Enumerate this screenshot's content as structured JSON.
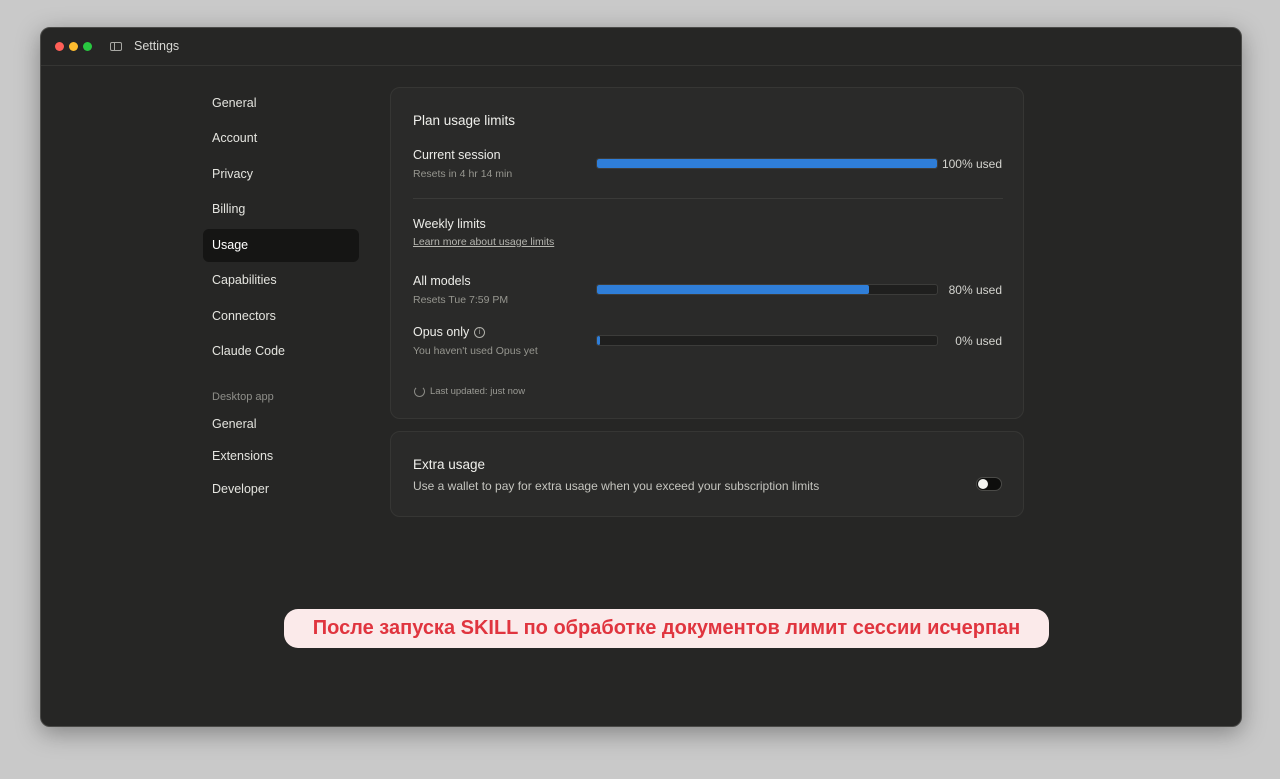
{
  "window": {
    "title": "Settings"
  },
  "nav": {
    "items": [
      {
        "label": "General"
      },
      {
        "label": "Account"
      },
      {
        "label": "Privacy"
      },
      {
        "label": "Billing"
      },
      {
        "label": "Usage",
        "active": true
      },
      {
        "label": "Capabilities"
      },
      {
        "label": "Connectors"
      },
      {
        "label": "Claude Code"
      }
    ],
    "desktop_section_label": "Desktop app",
    "desktop_items": [
      {
        "label": "General"
      },
      {
        "label": "Extensions"
      },
      {
        "label": "Developer"
      }
    ]
  },
  "plan": {
    "title": "Plan usage limits",
    "current_session": {
      "label": "Current session",
      "sub": "Resets in 4 hr 14 min",
      "percent": 100,
      "value_text": "100% used"
    },
    "weekly": {
      "label": "Weekly limits",
      "link": "Learn more about usage limits"
    },
    "all_models": {
      "label": "All models",
      "sub": "Resets Tue 7:59 PM",
      "percent": 80,
      "value_text": "80% used"
    },
    "opus_only": {
      "label": "Opus only",
      "sub": "You haven't used Opus yet",
      "percent": 0,
      "value_text": "0% used"
    },
    "last_updated": "Last updated: just now"
  },
  "extra": {
    "title": "Extra usage",
    "description": "Use a wallet to pay for extra usage when you exceed your subscription limits",
    "enabled": false
  },
  "caption": {
    "text": "После запуска SKILL по обработке документов лимит сессии исчерпан"
  },
  "colors": {
    "accent": "#2f7ed8",
    "caption_text": "#e0353f",
    "caption_bg": "#fbeaea"
  }
}
